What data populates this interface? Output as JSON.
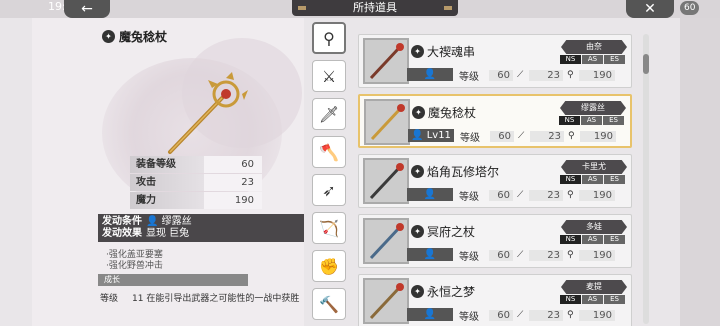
{
  "status": {
    "clock": "19:0",
    "battery": "60"
  },
  "header": {
    "title": "所持道具",
    "back_icon": "arrow-left-icon",
    "close_icon": "close-icon"
  },
  "detail": {
    "name": "魔兔稔杖",
    "stats": [
      {
        "label": "装备等级",
        "value": "60"
      },
      {
        "label": "攻击",
        "value": "23"
      },
      {
        "label": "魔力",
        "value": "190"
      }
    ],
    "skill_condition_label": "发动条件",
    "skill_condition_value": "缪露丝",
    "skill_effect_label": "发动效果",
    "skill_effect_value": "显现 巨兔",
    "effects": [
      "·强化盖亚要塞",
      "·强化野兽冲击"
    ],
    "growth_label": "成长",
    "level_label": "等级",
    "level_text": "11 在能引导出武器之可能性的一战中获胜"
  },
  "tabs": [
    "staff",
    "sword",
    "knife",
    "axe",
    "arrow",
    "bow",
    "fist",
    "hammer"
  ],
  "items": [
    {
      "name": "大禊魂串",
      "owner": "由奈",
      "level": "",
      "lv_label": "等级",
      "lv_value": "60",
      "atk": "23",
      "mag": "190",
      "selected": false
    },
    {
      "name": "魔兔稔杖",
      "owner": "缪露丝",
      "level": "Lv11",
      "lv_label": "等级",
      "lv_value": "60",
      "atk": "23",
      "mag": "190",
      "selected": true
    },
    {
      "name": "焰角瓦修塔尔",
      "owner": "卡里尤",
      "level": "",
      "lv_label": "等级",
      "lv_value": "60",
      "atk": "23",
      "mag": "190",
      "selected": false
    },
    {
      "name": "冥府之杖",
      "owner": "多娃",
      "level": "",
      "lv_label": "等级",
      "lv_value": "60",
      "atk": "23",
      "mag": "190",
      "selected": false
    },
    {
      "name": "永恒之梦",
      "owner": "麦提",
      "level": "",
      "lv_label": "等级",
      "lv_value": "60",
      "atk": "23",
      "mag": "190",
      "selected": false
    }
  ],
  "attr_tags": [
    "NS",
    "AS",
    "ES"
  ],
  "colors": {
    "selected_border": "#e8c36b",
    "panel_dark": "#4a474a"
  }
}
